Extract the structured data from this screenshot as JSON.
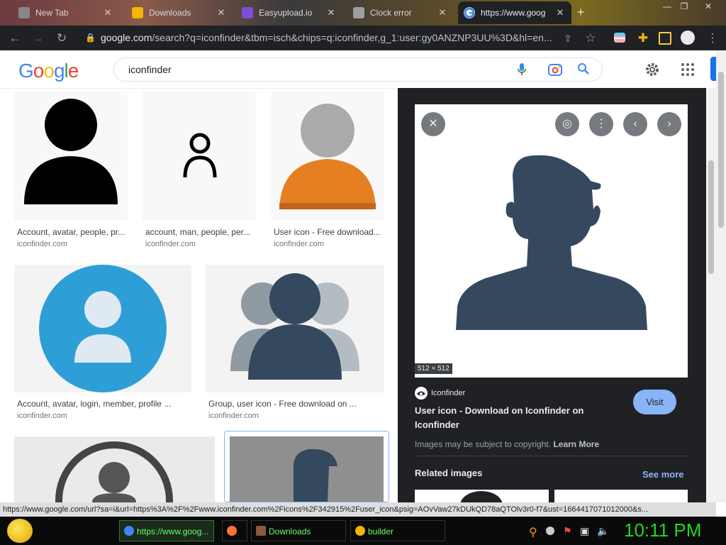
{
  "tabs": [
    {
      "title": "New Tab",
      "fav": "#888888"
    },
    {
      "title": "Downloads",
      "fav": "#f4b400"
    },
    {
      "title": "Easyupload.io",
      "fav": "#7b4fd6"
    },
    {
      "title": "Clock error",
      "fav": "#9e9e9e"
    },
    {
      "title": "https://www.goog",
      "fav": "#4285f4"
    }
  ],
  "toolbar": {
    "url_host": "google.com",
    "url_rest": "/search?q=iconfinder&tbm=isch&chips=q:iconfinder,g_1:user:gy0ANZNP3UU%3D&hl=en..."
  },
  "google": {
    "logo": [
      "G",
      "o",
      "o",
      "g",
      "l",
      "e"
    ],
    "logo_colors": [
      "#4285f4",
      "#ea4335",
      "#fbbc05",
      "#4285f4",
      "#34a853",
      "#ea4335"
    ],
    "query": "iconfinder"
  },
  "results": [
    {
      "caption": "Account, avatar, people, pr...",
      "source": "iconfinder.com"
    },
    {
      "caption": "account, man, people, per...",
      "source": "iconfinder.com"
    },
    {
      "caption": "User icon - Free download...",
      "source": "iconfinder.com"
    },
    {
      "caption": "Account, avatar, login, member, profile ...",
      "source": "iconfinder.com"
    },
    {
      "caption": "Group, user icon - Free download on ...",
      "source": "iconfinder.com"
    }
  ],
  "panel": {
    "dimensions": "512 × 512",
    "site": "Iconfinder",
    "title_line1": "User icon - Download on Iconfinder on",
    "title_line2": "Iconfinder",
    "copyright": "Images may be subject to copyright.",
    "learn_more": "Learn More",
    "visit": "Visit",
    "related": "Related images",
    "see_more": "See more"
  },
  "status_url": "https://www.google.com/url?sa=i&url=https%3A%2F%2Fwww.iconfinder.com%2Ficons%2F342915%2Fuser_icon&psig=AOvVaw27kDUkQD78aQTOlv3r0-f7&ust=1664417071012000&s...",
  "taskbar": {
    "items": [
      {
        "label": "https://www.goog...",
        "color": "#4285f4"
      },
      {
        "label": "",
        "color": "#ff7139"
      },
      {
        "label": "Downloads",
        "color": "#8a5a3a"
      },
      {
        "label": "builder",
        "color": "#f4b400"
      }
    ],
    "clock": "10:11 PM"
  },
  "colors": {
    "accent": "#8ab4f8",
    "panel_bg": "#202124",
    "icon_navy": "#34495e",
    "icon_orange": "#e67e22",
    "icon_blue": "#2e9fd6"
  }
}
